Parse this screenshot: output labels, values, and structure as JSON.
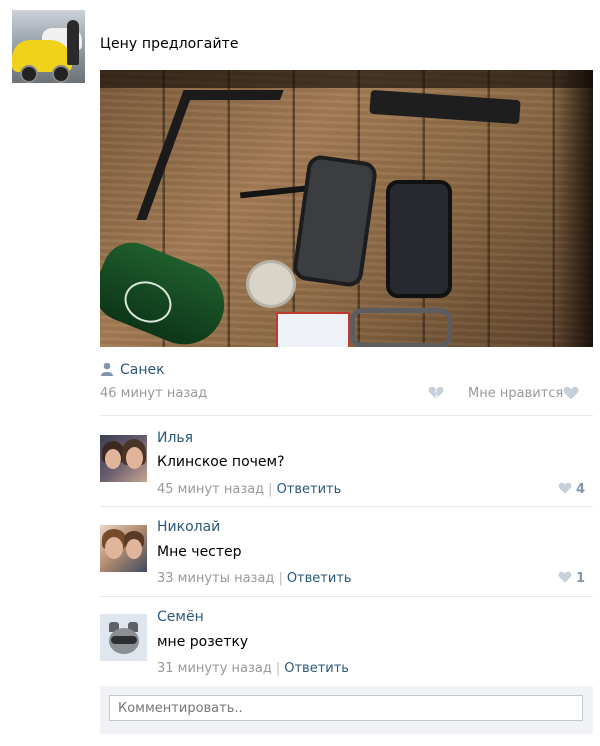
{
  "post": {
    "text": "Цену предлогайте",
    "author": "Санек",
    "time": "46 минут назад",
    "like_label": "Мне нравится",
    "icons": {
      "author": "user-icon",
      "unlike": "broken-heart-icon",
      "like": "heart-icon"
    }
  },
  "comments": [
    {
      "name": "Илья",
      "text": "Клинское почем?",
      "time": "45 минут назад",
      "reply": "Ответить",
      "likes": "4"
    },
    {
      "name": "Николай",
      "text": "Мне честер",
      "time": "33 минуты назад",
      "reply": "Ответить",
      "likes": "1"
    },
    {
      "name": "Семён",
      "text": "мне розетку",
      "time": "31 минуту назад",
      "reply": "Ответить",
      "likes": ""
    }
  ],
  "comment_box": {
    "placeholder": "Комментировать.."
  },
  "colors": {
    "link": "#2b587a",
    "meta": "#999999",
    "like": "#7f95ac"
  }
}
